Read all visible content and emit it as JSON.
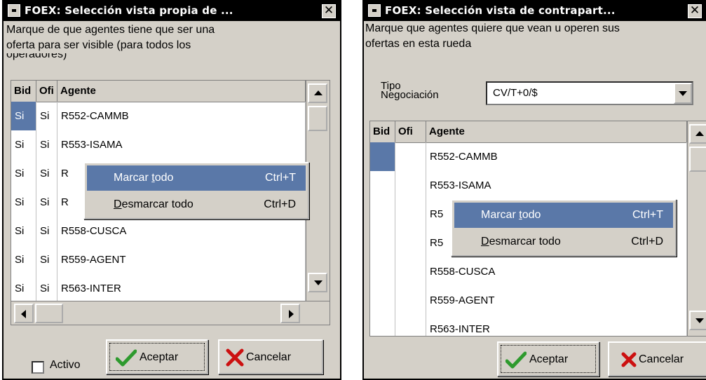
{
  "left_dialog": {
    "title": "FOEX: Selección vista propia de ...",
    "description": [
      "Marque de que agentes tiene que ser una",
      "oferta para ser visible (para todos los",
      "operadores)"
    ],
    "columns": [
      "Bid",
      "Ofi",
      "Agente"
    ],
    "rows": [
      {
        "bid": "Si",
        "ofi": "Si",
        "agente": "R552-CAMMB"
      },
      {
        "bid": "Si",
        "ofi": "Si",
        "agente": "R553-ISAMA"
      },
      {
        "bid": "Si",
        "ofi": "Si",
        "agente": "R"
      },
      {
        "bid": "Si",
        "ofi": "Si",
        "agente": "R"
      },
      {
        "bid": "Si",
        "ofi": "Si",
        "agente": "R558-CUSCA"
      },
      {
        "bid": "Si",
        "ofi": "Si",
        "agente": "R559-AGENT"
      },
      {
        "bid": "Si",
        "ofi": "Si",
        "agente": "R563-INTER"
      }
    ],
    "context_menu": {
      "items": [
        {
          "pre": "Marcar ",
          "accel": "t",
          "post": "odo",
          "shortcut": "Ctrl+T"
        },
        {
          "pre": "",
          "accel": "D",
          "post": "esmarcar todo",
          "shortcut": "Ctrl+D"
        }
      ]
    },
    "activo_label": "Activo",
    "accept_label": "Aceptar",
    "cancel_label": "Cancelar"
  },
  "right_dialog": {
    "title": "FOEX: Selección vista de contrapart...",
    "description": [
      "Marque que agentes quiere que vean u operen sus",
      "ofertas en esta rueda"
    ],
    "tipo_label_1": "Tipo",
    "tipo_label_2": "Negociación",
    "tipo_value": "CV/T+0/$",
    "columns": [
      "Bid",
      "Ofi",
      "Agente"
    ],
    "rows": [
      {
        "bid": "",
        "ofi": "",
        "agente": "R552-CAMMB"
      },
      {
        "bid": "",
        "ofi": "",
        "agente": "R553-ISAMA"
      },
      {
        "bid": "",
        "ofi": "",
        "agente": "R5"
      },
      {
        "bid": "",
        "ofi": "",
        "agente": "R5"
      },
      {
        "bid": "",
        "ofi": "",
        "agente": "R558-CUSCA"
      },
      {
        "bid": "",
        "ofi": "",
        "agente": "R559-AGENT"
      },
      {
        "bid": "",
        "ofi": "",
        "agente": "R563-INTER"
      }
    ],
    "context_menu": {
      "items": [
        {
          "pre": "Marcar ",
          "accel": "t",
          "post": "odo",
          "shortcut": "Ctrl+T"
        },
        {
          "pre": "",
          "accel": "D",
          "post": "esmarcar todo",
          "shortcut": "Ctrl+D"
        }
      ]
    },
    "accept_label": "Aceptar",
    "cancel_label": "Cancelar"
  },
  "colors": {
    "selection": "#5a78a8",
    "face": "#d4d0c8",
    "title_bar": "#000000"
  }
}
